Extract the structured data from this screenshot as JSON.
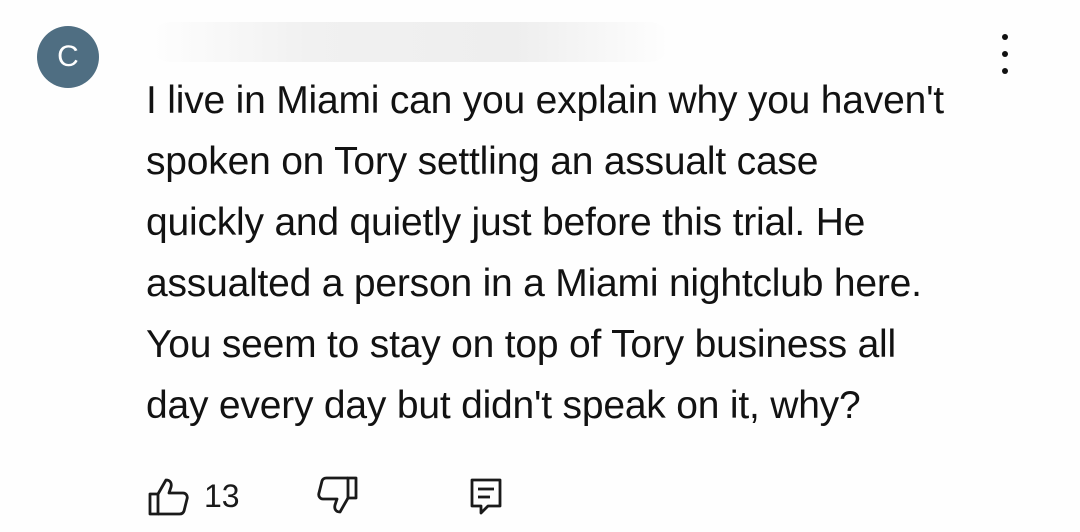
{
  "comment": {
    "avatar_initial": "C",
    "text": "I live in Miami can you explain why you haven't\nspoken on Tory settling an  assualt case\nquickly  and quietly just before this trial. He\nassualted a person in a Miami nightclub here.\nYou seem to stay on top of Tory business all\nday every day but didn't speak on it, why?",
    "like_count": "13"
  },
  "icons": {
    "menu": "more-vertical-icon",
    "like": "thumbs-up-icon",
    "dislike": "thumbs-down-icon",
    "reply": "reply-comment-icon"
  },
  "colors": {
    "avatar_background": "#4f6e82",
    "text": "#121212"
  }
}
